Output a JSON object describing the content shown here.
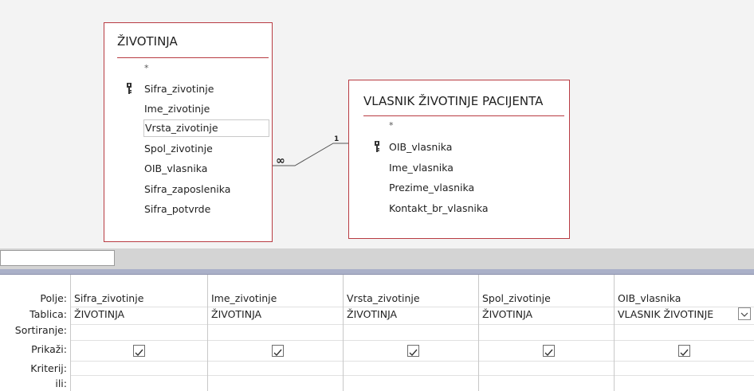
{
  "tables": {
    "zivotinja": {
      "title": "ŽIVOTINJA",
      "star": "*",
      "fields": [
        "Sifra_zivotinje",
        "Ime_zivotinje",
        "Vrsta_zivotinje",
        "Spol_zivotinje",
        "OIB_vlasnika",
        "Sifra_zaposlenika",
        "Sifra_potvrde"
      ]
    },
    "vlasnik": {
      "title": "VLASNIK ŽIVOTINJE PACIJENTA",
      "star": "*",
      "fields": [
        "OIB_vlasnika",
        "Ime_vlasnika",
        "Prezime_vlasnika",
        "Kontakt_br_vlasnika"
      ]
    }
  },
  "relationship": {
    "many_label": "∞",
    "one_label": "1"
  },
  "grid": {
    "row_labels": [
      "Polje:",
      "Tablica:",
      "Sortiranje:",
      "Prikaži:",
      "Kriterij:",
      "ili:"
    ],
    "columns": [
      {
        "field": "Sifra_zivotinje",
        "table": "ŽIVOTINJA",
        "show": true
      },
      {
        "field": "Ime_zivotinje",
        "table": "ŽIVOTINJA",
        "show": true
      },
      {
        "field": "Vrsta_zivotinje",
        "table": "ŽIVOTINJA",
        "show": true
      },
      {
        "field": "Spol_zivotinje",
        "table": "ŽIVOTINJA",
        "show": true
      },
      {
        "field": "OIB_vlasnika",
        "table": "VLASNIK ŽIVOTINJE",
        "show": true
      }
    ]
  },
  "icons": {
    "primary_key": "key-icon",
    "checkbox": "checkmark-icon",
    "dropdown": "chevron-down-icon"
  },
  "colors": {
    "table_border": "#b83b42",
    "canvas_bg": "#f3f3f3",
    "nav_band": "#aab0c8"
  }
}
